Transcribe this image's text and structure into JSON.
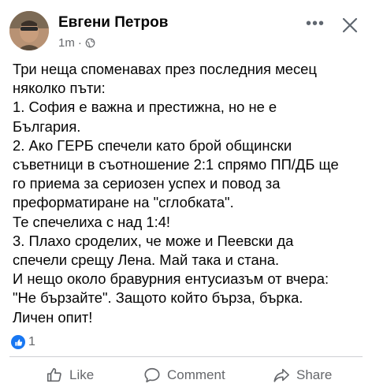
{
  "post": {
    "author": "Евгени Петров",
    "time": "1m",
    "separator": "·",
    "privacy_icon": "globe-icon",
    "more_label": "•••",
    "body_lines": [
      "Три неща споменавах през последния месец",
      "няколко пъти:",
      "1. София е важна и престижна, но не е",
      "България.",
      "2. Ако ГЕРБ спечели като брой общински",
      "съветници в съотношение 2:1 спрямо ПП/ДБ ще",
      "го приема за сериозен успех и повод за",
      "преформатиране на \"сглобката\".",
      "Те спечелиха с над 1:4!",
      "3. Плахо сроделих, че може и Пеевски да",
      "спечели срещу Лена. Май така и стана.",
      "И нещо около бравурния ентусиазъм от вчера:",
      "\"Не бързайте\". Защото който бърза, бърка.",
      "Личен опит!"
    ],
    "reaction_count": "1"
  },
  "actions": {
    "like": "Like",
    "comment": "Comment",
    "share": "Share"
  },
  "colors": {
    "accent": "#1877f2",
    "secondary_text": "#65676b",
    "divider": "#ced0d4"
  }
}
